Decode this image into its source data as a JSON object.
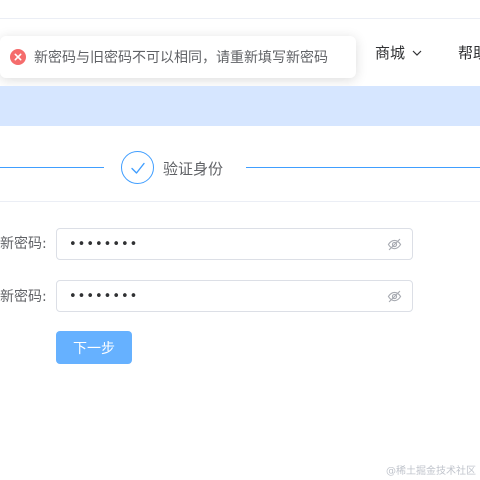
{
  "nav": {
    "mall_label": "商城",
    "help_label": "帮助"
  },
  "toast": {
    "message": "新密码与旧密码不可以相同，请重新填写新密码"
  },
  "steps": {
    "current_label": "验证身份"
  },
  "form": {
    "new_password_label": "新密码:",
    "new_password_value": "12345678",
    "confirm_password_label": "新密码:",
    "confirm_password_value": "12345678"
  },
  "actions": {
    "next_label": "下一步"
  },
  "watermark": "@稀土掘金技术社区",
  "colors": {
    "primary": "#409eff",
    "button": "#66b1ff",
    "band": "#d6e6ff",
    "error": "#f56c6c"
  }
}
